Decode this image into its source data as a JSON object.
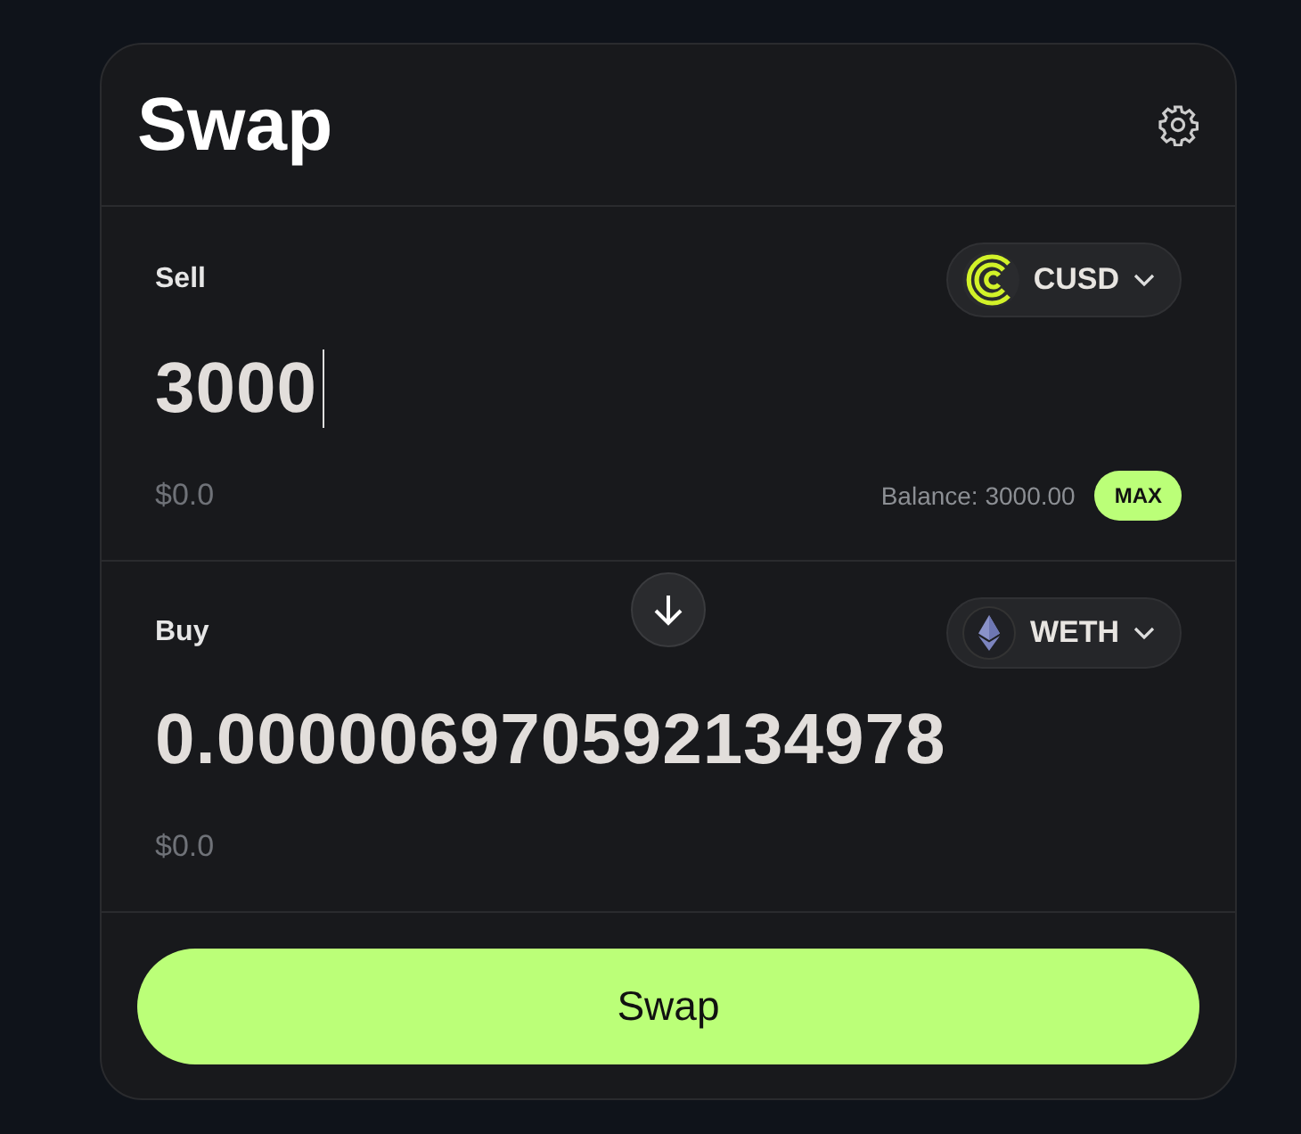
{
  "title": "Swap",
  "sell": {
    "label": "Sell",
    "token": {
      "symbol": "CUSD",
      "kind": "cusd"
    },
    "amount": "3000",
    "editing": true,
    "usd_value": "$0.0",
    "balance": "Balance: 3000.00",
    "max_button": "MAX"
  },
  "buy": {
    "label": "Buy",
    "token": {
      "symbol": "WETH",
      "kind": "weth"
    },
    "amount": "0.000006970592134978",
    "editing": false,
    "usd_value": "$0.0"
  },
  "swap_button": "Swap"
}
